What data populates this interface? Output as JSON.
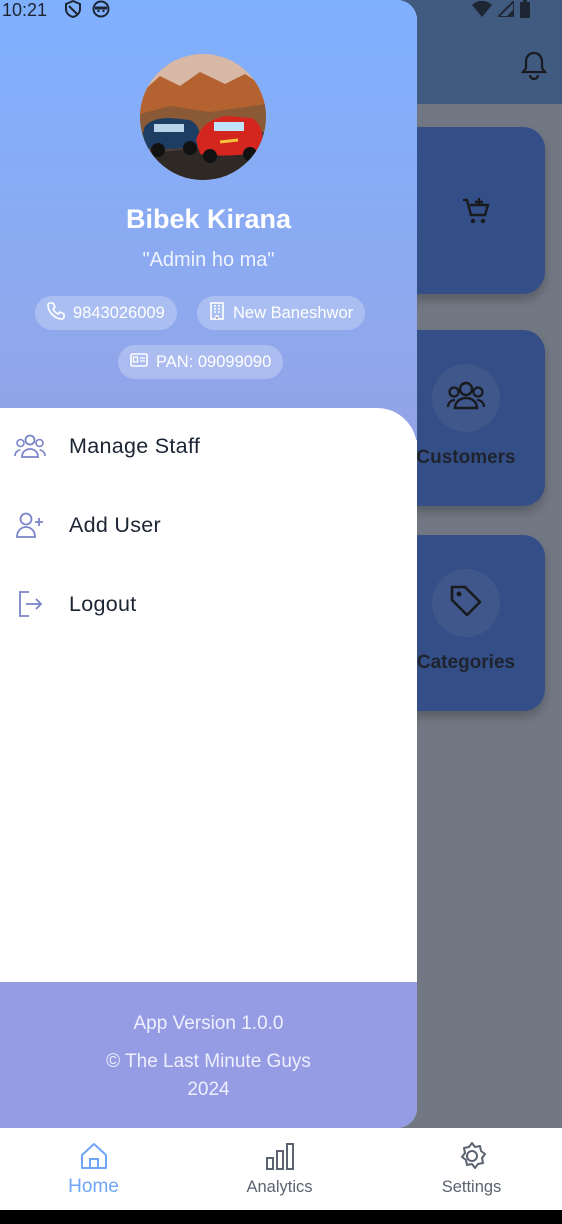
{
  "status_bar": {
    "time": "10:21"
  },
  "profile": {
    "name": "Bibek Kirana",
    "tagline": "\"Admin ho ma\"",
    "phone": "9843026009",
    "address": "New Baneshwor",
    "pan": "PAN: 09099090"
  },
  "menu": {
    "items": [
      {
        "label": "Manage Staff",
        "icon": "group-icon"
      },
      {
        "label": "Add User",
        "icon": "add-user-icon"
      },
      {
        "label": "Logout",
        "icon": "logout-icon"
      }
    ]
  },
  "footer": {
    "version": "App Version 1.0.0",
    "copyright": "© The Last Minute Guys",
    "year": "2024"
  },
  "background": {
    "cards": [
      {
        "label": "",
        "icon": "add-cart-icon"
      },
      {
        "label": "Customers",
        "icon": "group-icon"
      },
      {
        "label": "Categories",
        "icon": "tag-icon"
      }
    ]
  },
  "bottom_nav": {
    "items": [
      {
        "label": "Home",
        "icon": "home-icon",
        "active": true
      },
      {
        "label": "Analytics",
        "icon": "bar-chart-icon",
        "active": false
      },
      {
        "label": "Settings",
        "icon": "gear-icon",
        "active": false
      }
    ]
  },
  "colors": {
    "header_top": "#7fb0ff",
    "footer_bg": "#969ce3",
    "active_nav": "#6fa5f6",
    "menu_text": "#1b2433"
  }
}
